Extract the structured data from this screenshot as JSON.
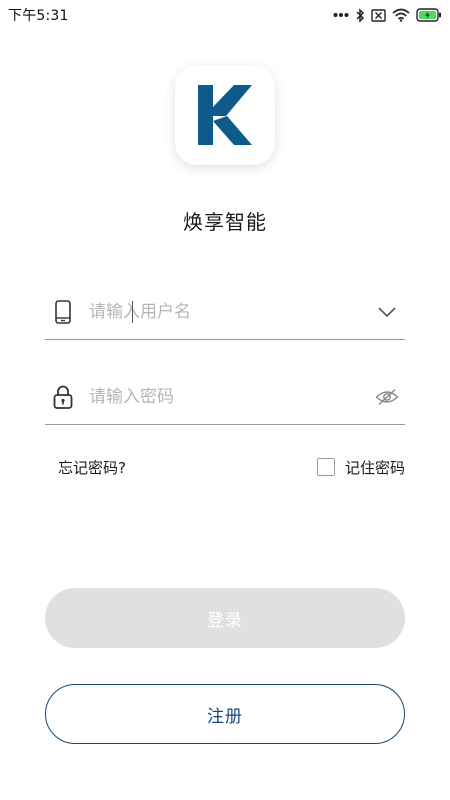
{
  "status_bar": {
    "time": "下午5:31",
    "icons": [
      "more-dots-icon",
      "bluetooth-icon",
      "sim-off-icon",
      "wifi-icon",
      "battery-charging-icon"
    ]
  },
  "app": {
    "name": "焕享智能",
    "logo_icon": "app-logo-icon",
    "brand_color": "#0e5a8a"
  },
  "form": {
    "username": {
      "placeholder": "请输入用户名",
      "value": "",
      "lead_icon": "phone-icon",
      "trail_icon": "chevron-down-icon"
    },
    "password": {
      "placeholder": "请输入密码",
      "value": "",
      "lead_icon": "lock-icon",
      "trail_icon": "eye-off-icon"
    },
    "forgot_label": "忘记密码?",
    "remember_label": "记住密码",
    "remember_checked": false
  },
  "buttons": {
    "login_label": "登录",
    "register_label": "注册",
    "accent_color": "#15497a"
  }
}
